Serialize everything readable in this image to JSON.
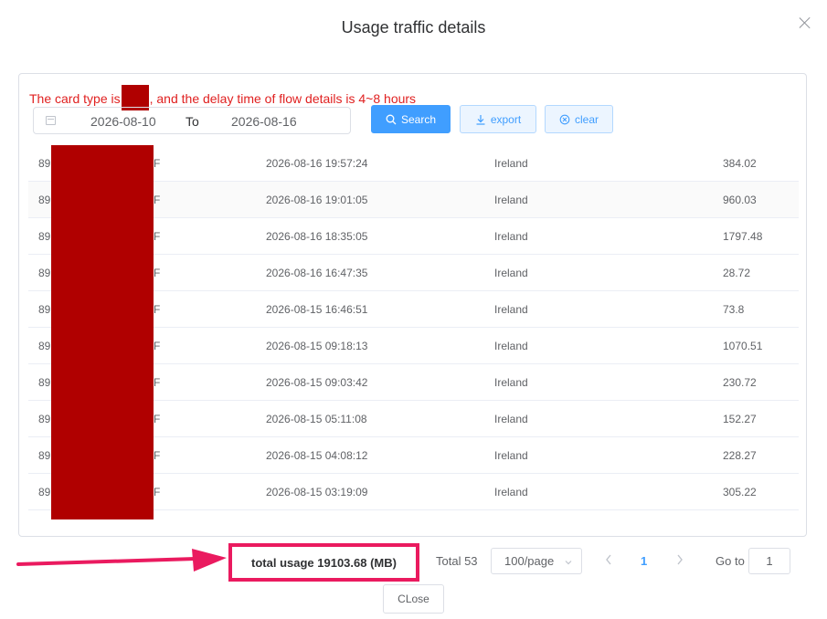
{
  "dialog": {
    "title": "Usage traffic details"
  },
  "notice": {
    "prefix": "The card type is",
    "suffix": ", and the delay time of flow details is 4~8 hours"
  },
  "filter": {
    "start_date": "2026-08-10",
    "to_label": "To",
    "end_date": "2026-08-16",
    "search_label": "Search",
    "export_label": "export",
    "clear_label": "clear"
  },
  "table": {
    "rows": [
      {
        "id": "89",
        "suffix": "F",
        "time": "2026-08-16 19:57:24",
        "country": "Ireland",
        "usage": "384.02"
      },
      {
        "id": "89",
        "suffix": "F",
        "time": "2026-08-16 19:01:05",
        "country": "Ireland",
        "usage": "960.03"
      },
      {
        "id": "89",
        "suffix": "F",
        "time": "2026-08-16 18:35:05",
        "country": "Ireland",
        "usage": "1797.48"
      },
      {
        "id": "89",
        "suffix": "F",
        "time": "2026-08-16 16:47:35",
        "country": "Ireland",
        "usage": "28.72"
      },
      {
        "id": "89",
        "suffix": "F",
        "time": "2026-08-15 16:46:51",
        "country": "Ireland",
        "usage": "73.8"
      },
      {
        "id": "89",
        "suffix": "F",
        "time": "2026-08-15 09:18:13",
        "country": "Ireland",
        "usage": "1070.51"
      },
      {
        "id": "89",
        "suffix": "F",
        "time": "2026-08-15 09:03:42",
        "country": "Ireland",
        "usage": "230.72"
      },
      {
        "id": "89",
        "suffix": "F",
        "time": "2026-08-15 05:11:08",
        "country": "Ireland",
        "usage": "152.27"
      },
      {
        "id": "89",
        "suffix": "F",
        "time": "2026-08-15 04:08:12",
        "country": "Ireland",
        "usage": "228.27"
      },
      {
        "id": "89",
        "suffix": "F",
        "time": "2026-08-15 03:19:09",
        "country": "Ireland",
        "usage": "305.22"
      }
    ]
  },
  "footer": {
    "total_usage": "total usage 19103.68 (MB)",
    "total_count": "Total 53",
    "page_size": "100/page",
    "current_page": "1",
    "goto_label": "Go to",
    "goto_value": "1",
    "close_label": "CLose"
  },
  "colors": {
    "accent": "#409eff",
    "highlight": "#ea1a5f",
    "notice": "#e02020",
    "redaction": "#b00000"
  },
  "icons": {
    "close": "close-icon",
    "calendar": "calendar-icon",
    "search": "search-icon",
    "export": "download-icon",
    "clear": "circle-x-icon",
    "arrow": "arrow-right-icon"
  }
}
